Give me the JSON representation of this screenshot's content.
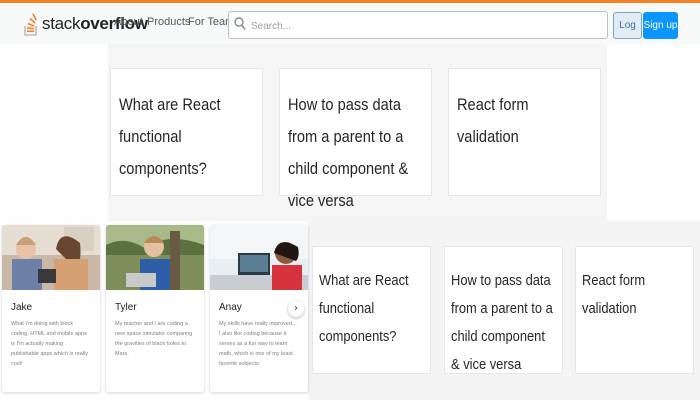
{
  "header": {
    "logo_text_light": "stack",
    "logo_text_bold": "overflow",
    "nav": [
      "About",
      "Products",
      "For Teams"
    ],
    "search_placeholder": "Search...",
    "login_label": "Log in",
    "signup_label": "Sign up"
  },
  "question_cards_top": [
    {
      "title": "What are React functional components?"
    },
    {
      "title": "How to pass data from a parent to a child component & vice versa"
    },
    {
      "title": "React form validation"
    }
  ],
  "profiles": [
    {
      "name": "Jake",
      "description": "What I'm doing with block coding, HTML and mobile apps is I'm actually making publishable apps which is really cool!"
    },
    {
      "name": "Tyler",
      "description": "My teacher and I are coding a new space simulator comparing the gravities of black holes to Mars."
    },
    {
      "name": "Anay",
      "description": "My skills have really improved... I also like coding because it serves as a fun way to learn math, which is one of my least favorite subjects."
    }
  ],
  "question_cards_bottom": [
    {
      "title": "What are React functional components?"
    },
    {
      "title": "How to pass data from a parent to a child component & vice versa"
    },
    {
      "title": "React form validation"
    }
  ],
  "carousel_next_icon": "chevron-right-icon",
  "colors": {
    "brand_orange": "#f48024",
    "signup_blue": "#0a95ff",
    "login_bg": "#e1ecf4"
  }
}
